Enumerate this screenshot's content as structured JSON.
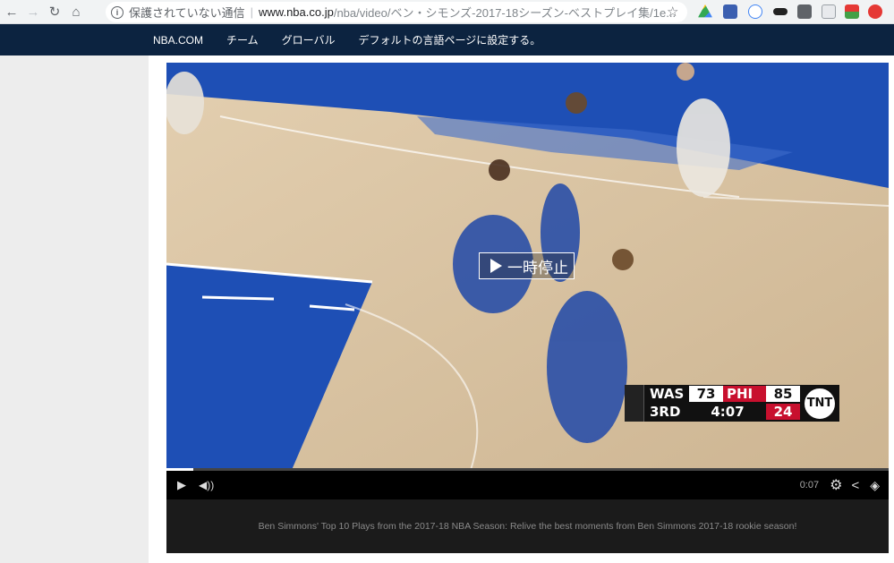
{
  "browser": {
    "security_label": "保護されていない通信",
    "url_host": "www.nba.co.jp",
    "url_path": "/nba/video/ベン・シモンズ-2017-18シーズン-ベストプレイ集/1e..."
  },
  "site_nav": {
    "items": [
      "NBA.COM",
      "チーム",
      "グローバル",
      "デフォルトの言語ページに設定する。"
    ]
  },
  "video": {
    "pause_label": "一時停止",
    "time": "0:07",
    "progress": 0.037
  },
  "scorebug": {
    "team1": "WAS",
    "score1": "73",
    "team2": "PHI",
    "score2": "85",
    "period": "3RD",
    "clock": "4:07",
    "shot_clock": "24",
    "network": "TNT"
  },
  "description": "Ben Simmons' Top 10 Plays from the 2017-18 NBA Season: Relive the best moments from Ben Simmons 2017-18 rookie season!",
  "colors": {
    "nav_bg": "#0c2340",
    "phi_red": "#c8102e",
    "court_blue": "#1e4fb5"
  }
}
